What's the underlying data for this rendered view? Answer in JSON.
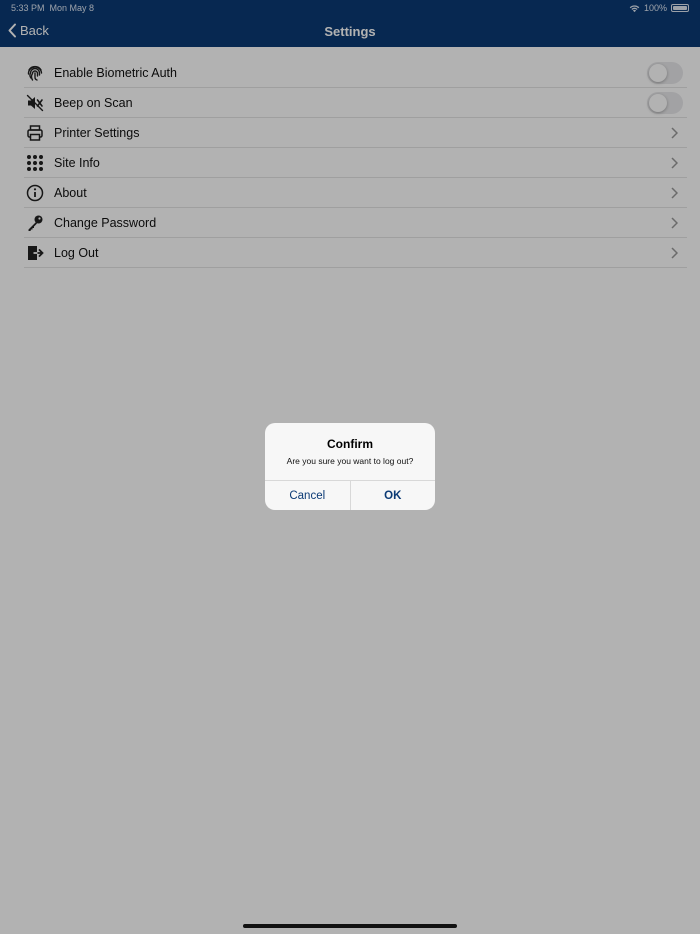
{
  "status_bar": {
    "time": "5:33 PM",
    "date": "Mon May 8",
    "battery": "100%"
  },
  "nav": {
    "back_label": "Back",
    "title": "Settings"
  },
  "settings": [
    {
      "icon": "fingerprint-icon",
      "label": "Enable Biometric Auth",
      "control": "toggle",
      "on": false
    },
    {
      "icon": "speaker-mute-icon",
      "label": "Beep on Scan",
      "control": "toggle",
      "on": false
    },
    {
      "icon": "printer-icon",
      "label": "Printer Settings",
      "control": "chevron"
    },
    {
      "icon": "grid-dots-icon",
      "label": "Site Info",
      "control": "chevron"
    },
    {
      "icon": "info-icon",
      "label": "About",
      "control": "chevron"
    },
    {
      "icon": "key-icon",
      "label": "Change Password",
      "control": "chevron"
    },
    {
      "icon": "logout-icon",
      "label": "Log Out",
      "control": "chevron"
    }
  ],
  "dialog": {
    "title": "Confirm",
    "message": "Are you sure you want to log out?",
    "cancel_label": "Cancel",
    "ok_label": "OK"
  },
  "colors": {
    "accent": "#0b3a75",
    "overlay": "rgba(0,0,0,0.30)"
  }
}
